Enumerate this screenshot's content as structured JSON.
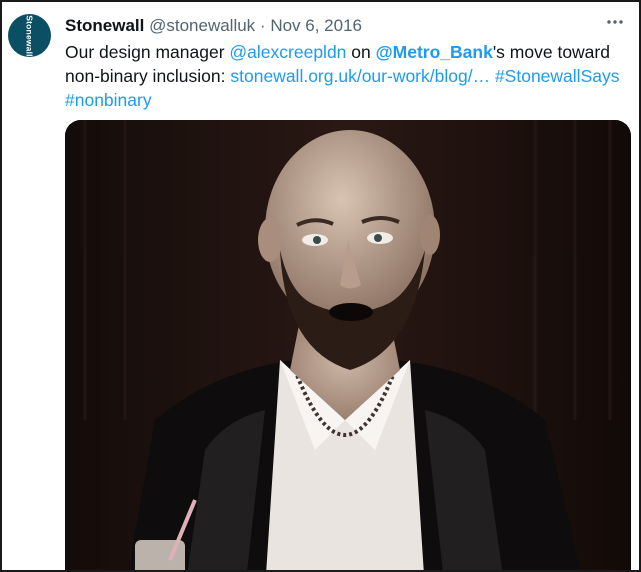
{
  "tweet": {
    "avatar_text": "Stonewall",
    "display_name": "Stonewall",
    "handle": "@stonewalluk",
    "separator": "·",
    "date": "Nov 6, 2016",
    "more_icon": "more-dots-icon",
    "text_parts": {
      "p1": "Our design manager ",
      "mention1": "@alexcreepldn",
      "p2": " on ",
      "mention2": "@Metro_Bank",
      "p3": "'s move toward non-binary inclusion: ",
      "url": "stonewall.org.uk/our-work/blog/…",
      "p4": " ",
      "hashtag1": "#StonewallSays",
      "p5": " ",
      "hashtag2": "#nonbinary"
    }
  },
  "colors": {
    "link": "#1d9bf0",
    "meta": "#536471",
    "avatar_bg": "#0b4f64"
  }
}
